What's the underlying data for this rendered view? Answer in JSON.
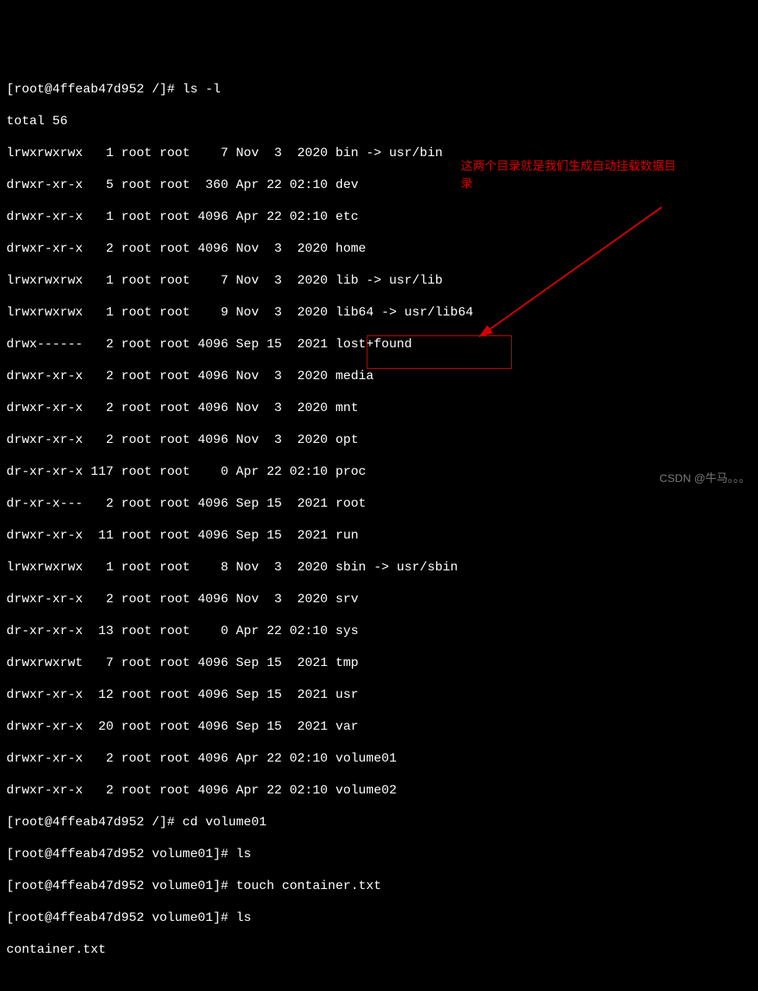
{
  "prompt1": {
    "open": "[",
    "host": "root@4ffeab47d952 /",
    "close": "]# ",
    "cmd": "ls -l"
  },
  "total": "total 56",
  "listing": [
    "lrwxrwxrwx   1 root root    7 Nov  3  2020 bin -> usr/bin",
    "drwxr-xr-x   5 root root  360 Apr 22 02:10 dev",
    "drwxr-xr-x   1 root root 4096 Apr 22 02:10 etc",
    "drwxr-xr-x   2 root root 4096 Nov  3  2020 home",
    "lrwxrwxrwx   1 root root    7 Nov  3  2020 lib -> usr/lib",
    "lrwxrwxrwx   1 root root    9 Nov  3  2020 lib64 -> usr/lib64",
    "drwx------   2 root root 4096 Sep 15  2021 lost+found",
    "drwxr-xr-x   2 root root 4096 Nov  3  2020 media",
    "drwxr-xr-x   2 root root 4096 Nov  3  2020 mnt",
    "drwxr-xr-x   2 root root 4096 Nov  3  2020 opt",
    "dr-xr-xr-x 117 root root    0 Apr 22 02:10 proc",
    "dr-xr-x---   2 root root 4096 Sep 15  2021 root",
    "drwxr-xr-x  11 root root 4096 Sep 15  2021 run",
    "lrwxrwxrwx   1 root root    8 Nov  3  2020 sbin -> usr/sbin",
    "drwxr-xr-x   2 root root 4096 Nov  3  2020 srv",
    "dr-xr-xr-x  13 root root    0 Apr 22 02:10 sys",
    "drwxrwxrwt   7 root root 4096 Sep 15  2021 tmp",
    "drwxr-xr-x  12 root root 4096 Sep 15  2021 usr",
    "drwxr-xr-x  20 root root 4096 Sep 15  2021 var"
  ],
  "volume_lines_pre": [
    "drwxr-xr-x   2 root root 4096 Apr 22 02:10 ",
    "drwxr-xr-x   2 root root 4096 Apr 22 02:10 "
  ],
  "volume_names": [
    "volume01",
    "volume02"
  ],
  "prompt2": {
    "open": "[",
    "host": "root@4ffeab47d952 /",
    "close": "]# ",
    "cmd": "cd volume01"
  },
  "prompt3": {
    "open": "[",
    "host": "root@4ffeab47d952 volume01",
    "close": "]# ",
    "cmd": "ls"
  },
  "prompt4": {
    "open": "[",
    "host": "root@4ffeab47d952 volume01",
    "close": "]# ",
    "cmd": "touch container.txt"
  },
  "prompt5": {
    "open": "[",
    "host": "root@4ffeab47d952 volume01",
    "close": "]# ",
    "cmd": "ls"
  },
  "ls_output": "container.txt",
  "annotation_l1": "这两个目录就是我们生成自动挂载数据目",
  "annotation_l2": "录",
  "watermark": "CSDN @牛马。。。"
}
